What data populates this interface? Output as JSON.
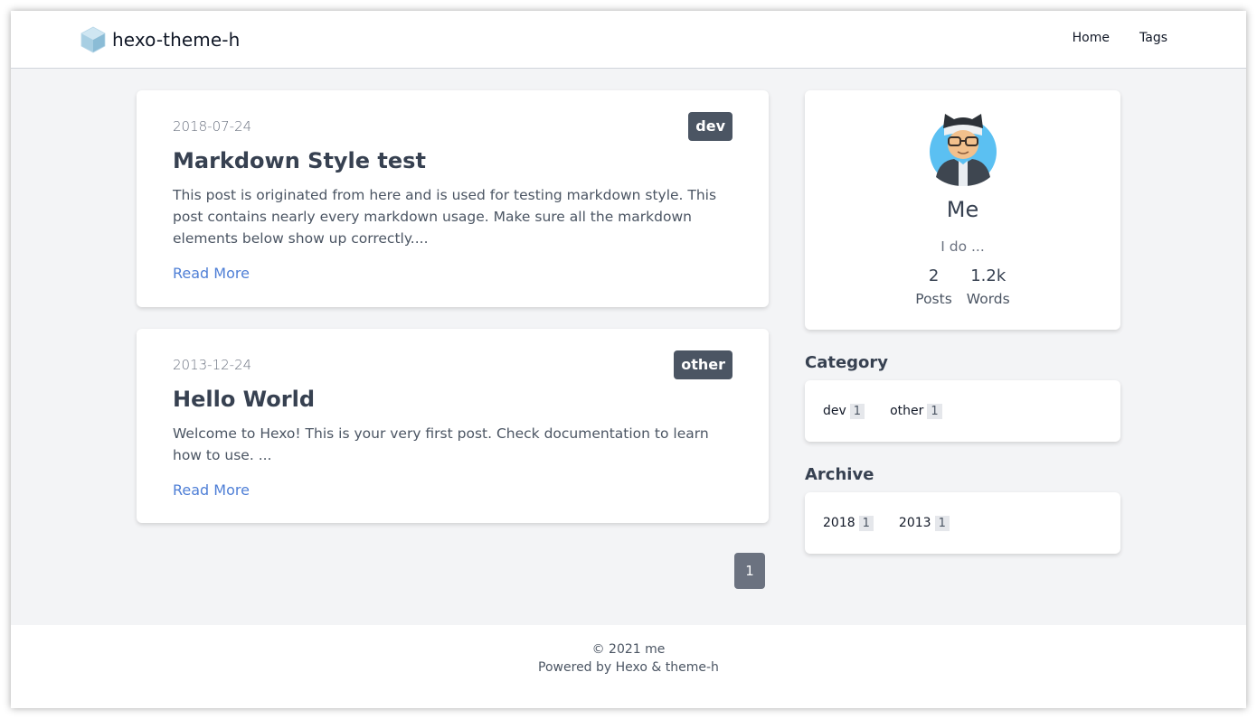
{
  "header": {
    "site_name": "hexo-theme-h",
    "logo_icon": "cube-icon",
    "nav": [
      {
        "label": "Home"
      },
      {
        "label": "Tags"
      }
    ]
  },
  "posts": [
    {
      "date": "2018-07-24",
      "tag": "dev",
      "title": "Markdown Style test",
      "excerpt": "This post is originated from here and is used for testing markdown style. This post contains nearly every markdown usage. Make sure all the markdown elements below show up correctly....",
      "read_more": "Read More"
    },
    {
      "date": "2013-12-24",
      "tag": "other",
      "title": "Hello World",
      "excerpt": "Welcome to Hexo! This is your very first post. Check documentation to learn how to use. ...",
      "read_more": "Read More"
    }
  ],
  "pagination": {
    "current": "1"
  },
  "profile": {
    "name": "Me",
    "bio": "I do ...",
    "stats": [
      {
        "value": "2",
        "label": "Posts"
      },
      {
        "value": "1.2k",
        "label": "Words"
      }
    ]
  },
  "category": {
    "heading": "Category",
    "items": [
      {
        "label": "dev",
        "count": "1"
      },
      {
        "label": "other",
        "count": "1"
      }
    ]
  },
  "archive": {
    "heading": "Archive",
    "items": [
      {
        "label": "2018",
        "count": "1"
      },
      {
        "label": "2013",
        "count": "1"
      }
    ]
  },
  "footer": {
    "copyright": "© 2021 me",
    "powered": "Powered by Hexo & theme-h"
  },
  "colors": {
    "background": "#f3f4f6",
    "tag_bg": "#4b5563",
    "link": "#4f7fd6",
    "page_button": "#6b7280"
  }
}
